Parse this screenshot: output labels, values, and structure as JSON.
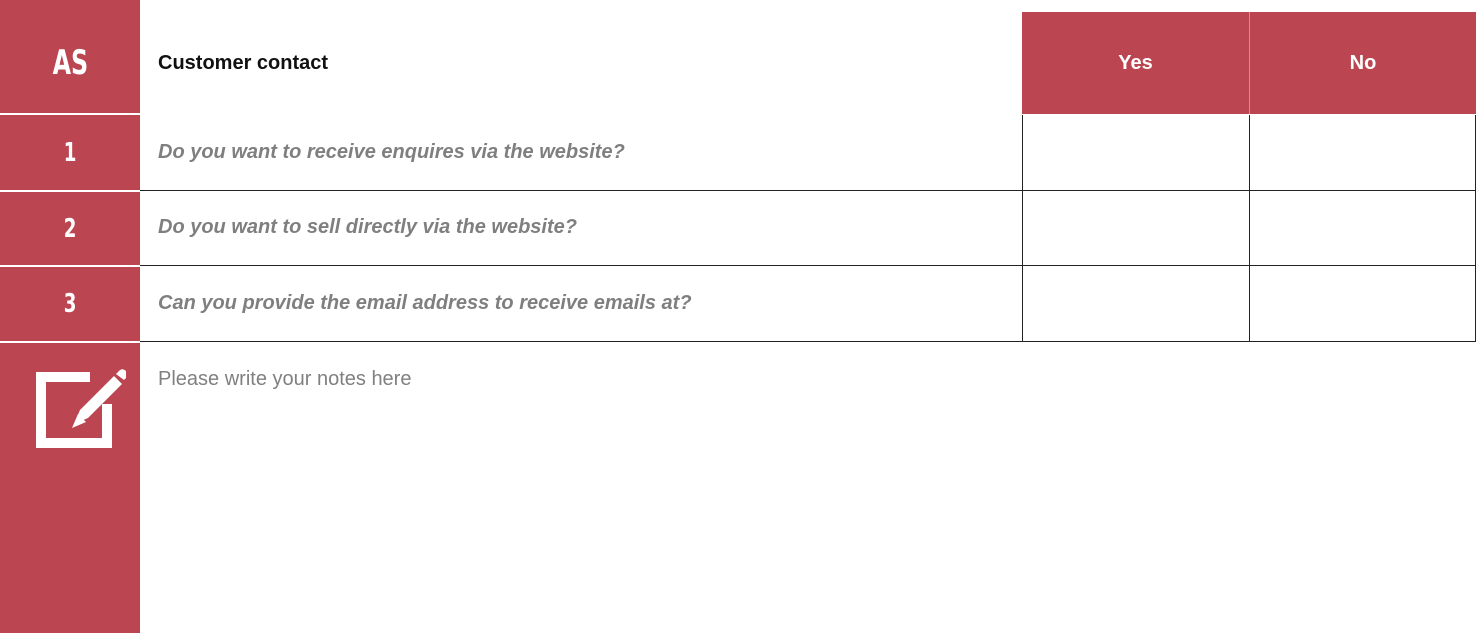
{
  "header": {
    "code": "AS",
    "title": "Customer contact",
    "yes_label": "Yes",
    "no_label": "No"
  },
  "questions": [
    {
      "number": "1",
      "text": "Do you want to receive enquires via the website?"
    },
    {
      "number": "2",
      "text": "Do you want to sell directly via the website?"
    },
    {
      "number": "3",
      "text": "Can you provide the email address to receive emails at?"
    }
  ],
  "notes": {
    "placeholder": "Please write your notes here",
    "icon": "edit-note-icon"
  },
  "colors": {
    "accent": "#bb4551",
    "question_text": "#7f7f7f",
    "notes_text": "#808080"
  }
}
